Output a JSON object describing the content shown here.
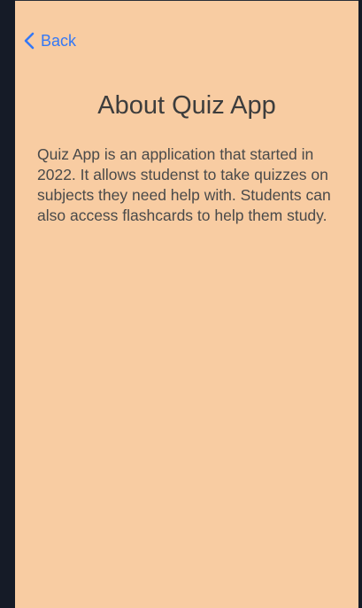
{
  "nav": {
    "back_label": "Back",
    "back_icon": "chevron-left-icon",
    "accent_color": "#3478f6"
  },
  "page": {
    "title": "About Quiz App",
    "description": "Quiz App is an application that started in 2022. It allows studenst to take quizzes on subjects they need help with. Students can also access flashcards to help them study.",
    "background_color": "#f8cca2"
  }
}
